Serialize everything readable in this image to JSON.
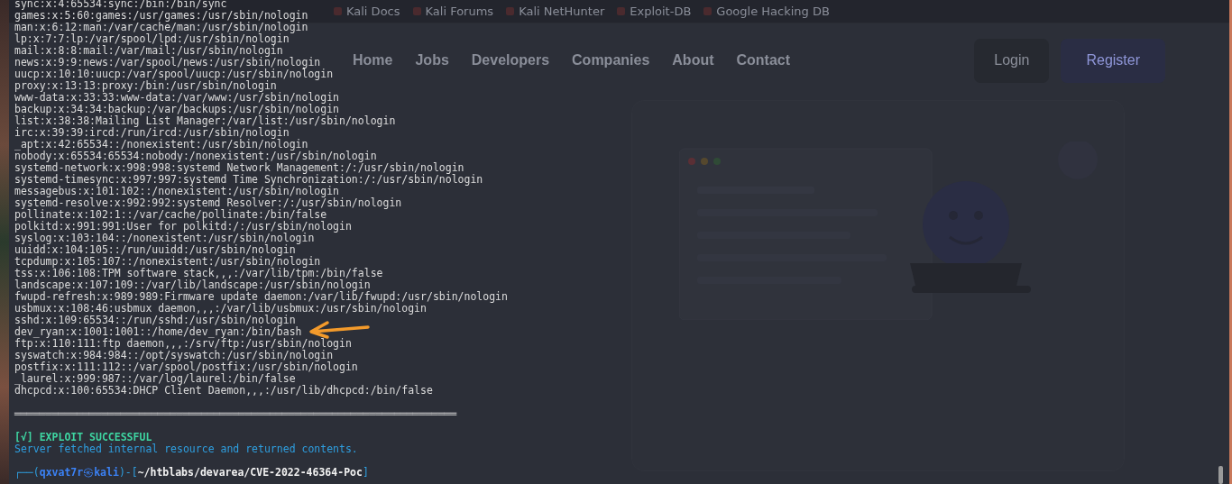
{
  "browser": {
    "bookmarks": [
      {
        "label": "Kali Docs"
      },
      {
        "label": "Kali Forums"
      },
      {
        "label": "Kali NetHunter"
      },
      {
        "label": "Exploit-DB"
      },
      {
        "label": "Google Hacking DB"
      }
    ],
    "nav": [
      "Home",
      "Jobs",
      "Developers",
      "Companies",
      "About",
      "Contact"
    ],
    "actions": [
      {
        "label": "Login",
        "kind": "secondary"
      },
      {
        "label": "Register",
        "kind": "primary"
      }
    ]
  },
  "terminal": {
    "lines": [
      "sync:x:4:65534:sync:/bin:/bin/sync",
      "games:x:5:60:games:/usr/games:/usr/sbin/nologin",
      "man:x:6:12:man:/var/cache/man:/usr/sbin/nologin",
      "lp:x:7:7:lp:/var/spool/lpd:/usr/sbin/nologin",
      "mail:x:8:8:mail:/var/mail:/usr/sbin/nologin",
      "news:x:9:9:news:/var/spool/news:/usr/sbin/nologin",
      "uucp:x:10:10:uucp:/var/spool/uucp:/usr/sbin/nologin",
      "proxy:x:13:13:proxy:/bin:/usr/sbin/nologin",
      "www-data:x:33:33:www-data:/var/www:/usr/sbin/nologin",
      "backup:x:34:34:backup:/var/backups:/usr/sbin/nologin",
      "list:x:38:38:Mailing List Manager:/var/list:/usr/sbin/nologin",
      "irc:x:39:39:ircd:/run/ircd:/usr/sbin/nologin",
      "_apt:x:42:65534::/nonexistent:/usr/sbin/nologin",
      "nobody:x:65534:65534:nobody:/nonexistent:/usr/sbin/nologin",
      "systemd-network:x:998:998:systemd Network Management:/:/usr/sbin/nologin",
      "systemd-timesync:x:997:997:systemd Time Synchronization:/:/usr/sbin/nologin",
      "messagebus:x:101:102::/nonexistent:/usr/sbin/nologin",
      "systemd-resolve:x:992:992:systemd Resolver:/:/usr/sbin/nologin",
      "pollinate:x:102:1::/var/cache/pollinate:/bin/false",
      "polkitd:x:991:991:User for polkitd:/:/usr/sbin/nologin",
      "syslog:x:103:104::/nonexistent:/usr/sbin/nologin",
      "uuidd:x:104:105::/run/uuidd:/usr/sbin/nologin",
      "tcpdump:x:105:107::/nonexistent:/usr/sbin/nologin",
      "tss:x:106:108:TPM software stack,,,:/var/lib/tpm:/bin/false",
      "landscape:x:107:109::/var/lib/landscape:/usr/sbin/nologin",
      "fwupd-refresh:x:989:989:Firmware update daemon:/var/lib/fwupd:/usr/sbin/nologin",
      "usbmux:x:108:46:usbmux daemon,,,:/var/lib/usbmux:/usr/sbin/nologin",
      "sshd:x:109:65534::/run/sshd:/usr/sbin/nologin",
      "dev_ryan:x:1001:1001::/home/dev_ryan:/bin/bash",
      "ftp:x:110:111:ftp daemon,,,:/srv/ftp:/usr/sbin/nologin",
      "syswatch:x:984:984::/opt/syswatch:/usr/sbin/nologin",
      "postfix:x:111:112::/var/spool/postfix:/usr/sbin/nologin",
      "_laurel:x:999:987::/var/log/laurel:/bin/false",
      "dhcpcd:x:100:65534:DHCP Client Daemon,,,:/usr/lib/dhcpcd:/bin/false"
    ],
    "separator": "═══════════════════════════════════════════════════════════════════════",
    "result": {
      "status": "[√] EXPLOIT SUCCESSFUL",
      "message": "Server fetched internal resource and returned contents."
    },
    "prompt": {
      "open": "┌──(",
      "user": "qxvat7r",
      "at": "㉿",
      "host": "kali",
      "mid": ")-[",
      "path": "~/htblabs/devarea/CVE-2022-46364-Poc",
      "close": "]"
    }
  }
}
